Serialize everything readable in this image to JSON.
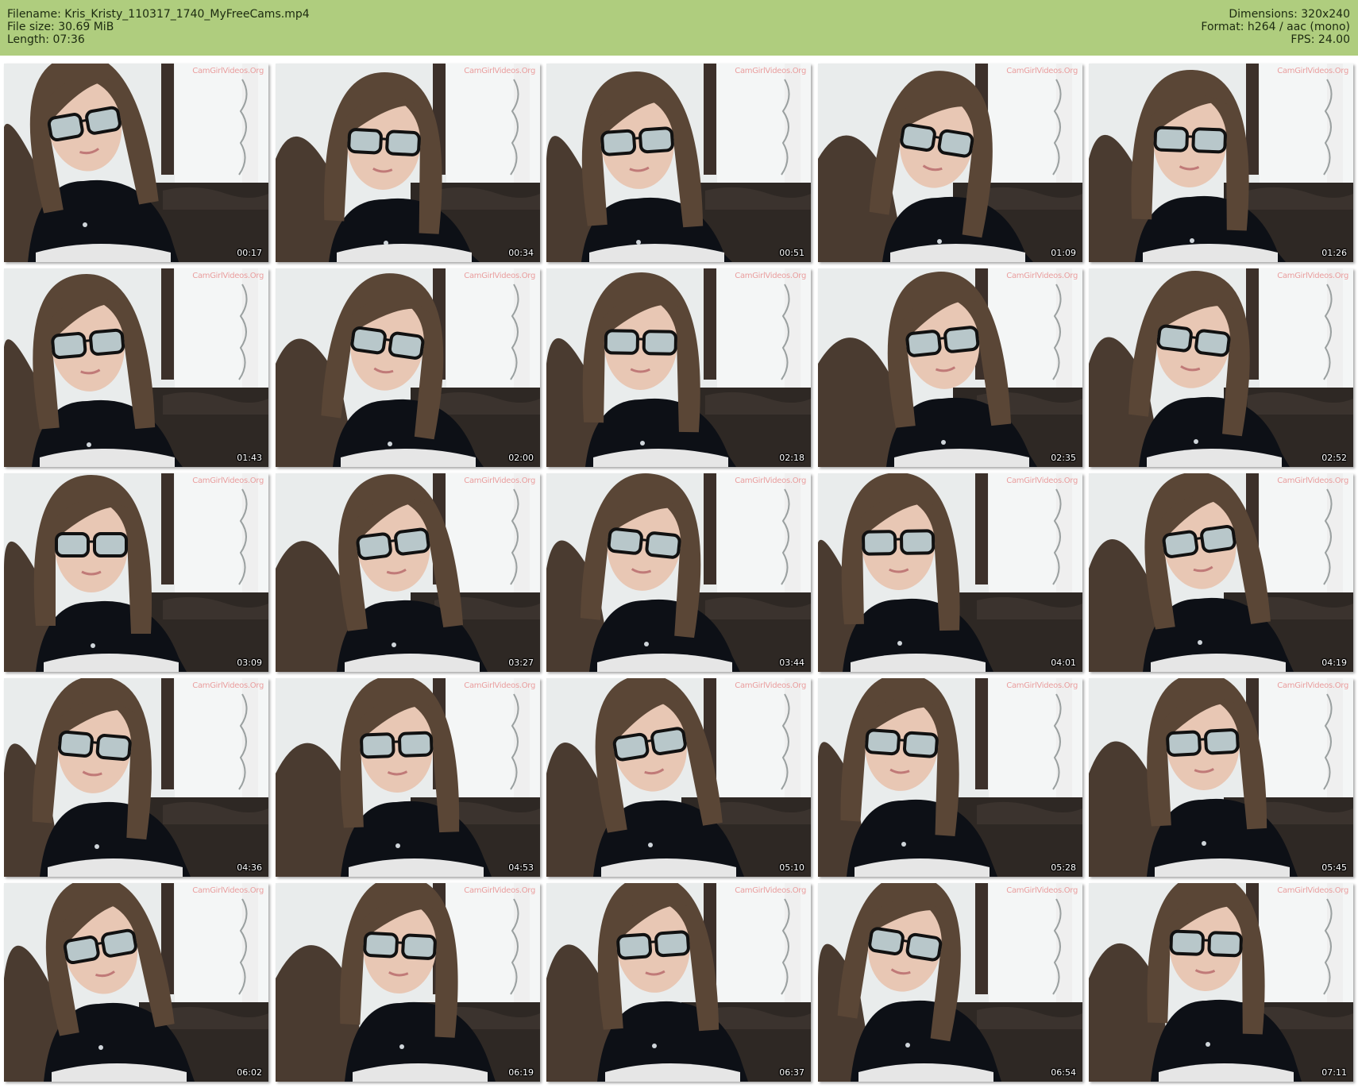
{
  "header": {
    "left": [
      "Filename: Kris_Kristy_110317_1740_MyFreeCams.mp4",
      "File size: 30.69 MiB",
      "Length: 07:36"
    ],
    "right": [
      "Dimensions: 320x240",
      "Format: h264 / aac (mono)",
      "FPS: 24.00"
    ]
  },
  "watermark": "CamGirlVideos.Org",
  "colors": {
    "header_bg": "#afcd7e",
    "page_bg": "#ffffff"
  },
  "thumbnails": [
    {
      "time": "00:17"
    },
    {
      "time": "00:34"
    },
    {
      "time": "00:51"
    },
    {
      "time": "01:09"
    },
    {
      "time": "01:26"
    },
    {
      "time": "01:43"
    },
    {
      "time": "02:00"
    },
    {
      "time": "02:18"
    },
    {
      "time": "02:35"
    },
    {
      "time": "02:52"
    },
    {
      "time": "03:09"
    },
    {
      "time": "03:27"
    },
    {
      "time": "03:44"
    },
    {
      "time": "04:01"
    },
    {
      "time": "04:19"
    },
    {
      "time": "04:36"
    },
    {
      "time": "04:53"
    },
    {
      "time": "05:10"
    },
    {
      "time": "05:28"
    },
    {
      "time": "05:45"
    },
    {
      "time": "06:02"
    },
    {
      "time": "06:19"
    },
    {
      "time": "06:37"
    },
    {
      "time": "06:54"
    },
    {
      "time": "07:11"
    }
  ]
}
